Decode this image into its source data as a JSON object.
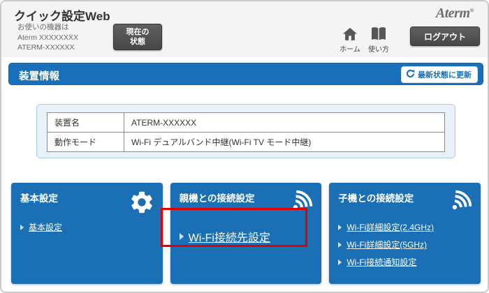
{
  "header": {
    "app_title": "クイック設定Web",
    "device_note": "お使いの機器は",
    "device_line1": "Aterm XXXXXXXX",
    "device_line2": "ATERM-XXXXXX",
    "status_line1": "現在の",
    "status_line2": "状態",
    "brand": "Aterm",
    "home_label": "ホーム",
    "guide_label": "使い方",
    "logout_label": "ログアウト"
  },
  "section_bar": {
    "title": "装置情報",
    "refresh_label": "最新状態に更新"
  },
  "device_table": {
    "rows": [
      {
        "label": "装置名",
        "value": "ATERM-XXXXXX"
      },
      {
        "label": "動作モード",
        "value": "Wi-Fi デュアルバンド中継(Wi-Fi TV モード中継)"
      }
    ]
  },
  "panels": [
    {
      "title": "基本設定",
      "icon": "gear-icon",
      "links": [
        {
          "label": "基本設定",
          "highlighted": false
        }
      ]
    },
    {
      "title": "親機との接続設定",
      "icon": "wifi-icon",
      "links": [
        {
          "label": "Wi-Fi接続先設定",
          "highlighted": true
        }
      ]
    },
    {
      "title": "子機との接続設定",
      "icon": "wifi-icon",
      "links": [
        {
          "label": "Wi-Fi詳細設定(2.4GHz)",
          "highlighted": false
        },
        {
          "label": "Wi-Fi詳細設定(5GHz)",
          "highlighted": false
        },
        {
          "label": "Wi-Fi接続通知設定",
          "highlighted": false
        }
      ]
    }
  ],
  "colors": {
    "accent_blue": "#1a6fb5",
    "highlight_red": "#e10000",
    "button_dark": "#4b4b4b",
    "header_gray": "#f4f4f4"
  }
}
